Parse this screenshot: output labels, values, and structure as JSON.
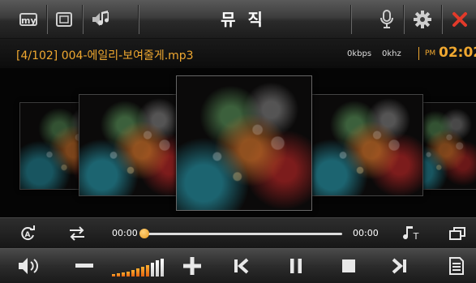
{
  "header": {
    "title": "뮤 직",
    "my_label": "my"
  },
  "info": {
    "track": "[4/102] 004-에일리-보여줄게.mp3",
    "bitrate": "0kbps",
    "samplerate": "0khz",
    "ampm": "PM",
    "time": "02:02"
  },
  "progress": {
    "elapsed": "00:00",
    "total": "00:00",
    "fraction": 0
  },
  "volume": {
    "level_bars": 10,
    "filled_bars": 10
  },
  "colors": {
    "accent": "#f0a830",
    "close": "#e23a2a"
  }
}
